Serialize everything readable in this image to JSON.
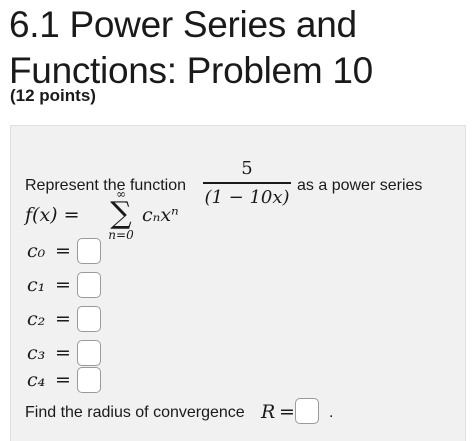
{
  "header": {
    "title": "6.1 Power Series and Functions: Problem 10",
    "points": "(12 points)"
  },
  "problem": {
    "prompt_before": "Represent the function",
    "fraction_numerator": "5",
    "fraction_denominator": "(1 − 10x)",
    "prompt_after": "as a power series",
    "series_lhs": "f(x) =",
    "sigma_upper": "∞",
    "sigma_symbol": "∑",
    "sigma_lower": "n=0",
    "series_term": "cₙxⁿ",
    "coefficients": [
      {
        "label": "c₀",
        "equals": "=",
        "value": ""
      },
      {
        "label": "c₁",
        "equals": "=",
        "value": ""
      },
      {
        "label": "c₂",
        "equals": "=",
        "value": ""
      },
      {
        "label": "c₃",
        "equals": "=",
        "value": ""
      },
      {
        "label": "c₄",
        "equals": "=",
        "value": ""
      }
    ],
    "radius_text": "Find the radius of convergence",
    "radius_var": "R",
    "radius_equals": "=",
    "radius_value": "",
    "radius_period": "."
  }
}
